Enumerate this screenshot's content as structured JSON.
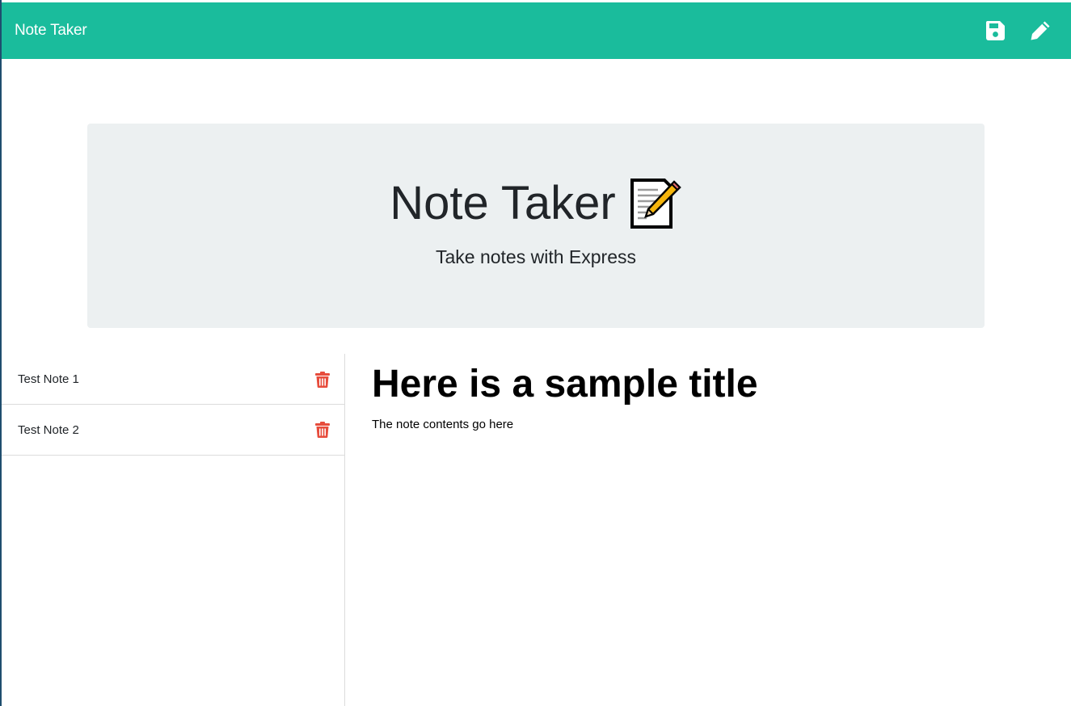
{
  "navbar": {
    "brand": "Note Taker",
    "save_icon": "floppy-disk-icon",
    "new_icon": "pencil-icon",
    "bg_color": "#1abc9c"
  },
  "jumbotron": {
    "title": "Note Taker",
    "title_icon": "memo-icon",
    "subtitle": "Take notes with Express"
  },
  "notes_list": {
    "items": [
      {
        "label": "Test Note 1",
        "delete_icon": "trash-icon"
      },
      {
        "label": "Test Note 2",
        "delete_icon": "trash-icon"
      }
    ],
    "delete_color": "#e74c3c"
  },
  "editor": {
    "title": "Here is a sample title",
    "text": "The note contents go here"
  }
}
